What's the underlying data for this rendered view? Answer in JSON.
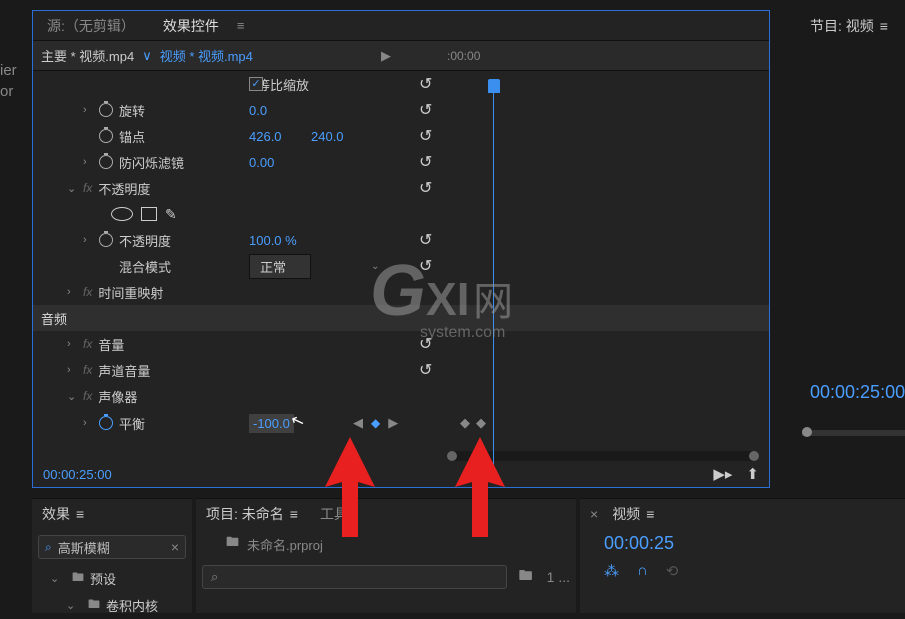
{
  "left_edge": "ier\nor",
  "tabs": {
    "source": "源:（无剪辑）",
    "effect_controls": "效果控件"
  },
  "clip": {
    "master": "主要 * 视频.mp4",
    "sequence": "视频 * 视频.mp4",
    "timeruler": ":00:00"
  },
  "props": {
    "uniform_scale": "等比缩放",
    "rotation": {
      "label": "旋转",
      "value": "0.0"
    },
    "anchor": {
      "label": "锚点",
      "x": "426.0",
      "y": "240.0"
    },
    "antiflicker": {
      "label": "防闪烁滤镜",
      "value": "0.00"
    },
    "opacity_section": "不透明度",
    "opacity": {
      "label": "不透明度",
      "value": "100.0 %"
    },
    "blend": {
      "label": "混合模式",
      "value": "正常"
    },
    "time_remap": "时间重映射",
    "audio_section": "音频",
    "volume": "音量",
    "channel_volume": "声道音量",
    "panner": "声像器",
    "balance": {
      "label": "平衡",
      "value": "-100.0"
    }
  },
  "footer": {
    "time": "00:00:25:00"
  },
  "program": {
    "tab": "节目: 视频",
    "time": "00:00:25:00"
  },
  "effects": {
    "tab": "效果",
    "search": "高斯模糊",
    "preset": "预设",
    "conv": "卷积内核"
  },
  "project": {
    "tab": "项目: 未命名",
    "tools_tab": "工具",
    "file": "未命名.prproj",
    "count": "1 ..."
  },
  "timeline": {
    "tab": "视频",
    "time": "00:00:25"
  },
  "watermark": {
    "g": "G",
    "xi": "XI",
    "wang": "网",
    "sub": "system.com"
  }
}
